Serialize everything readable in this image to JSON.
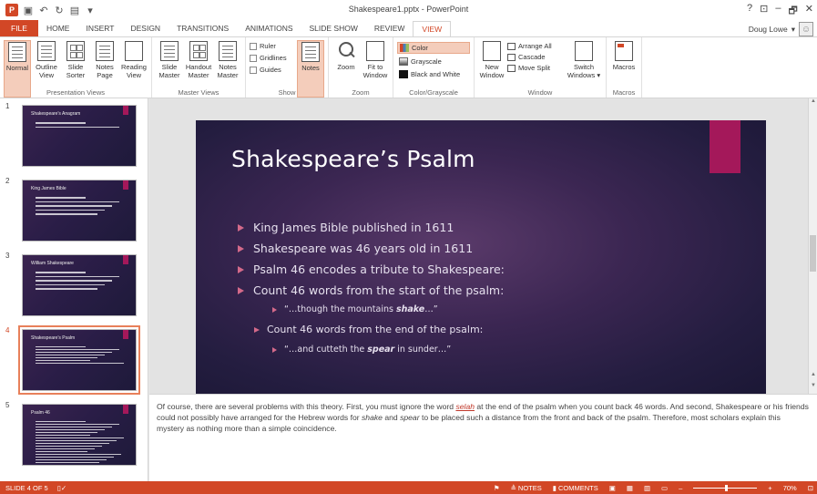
{
  "titlebar": {
    "doc_title": "Shakespeare1.pptx - PowerPoint",
    "app_logo": "P",
    "qat": [
      "save-icon",
      "undo-icon",
      "redo-icon",
      "start-from-beginning-icon",
      "customize-icon"
    ],
    "controls": {
      "help": "?",
      "ribbon_display": "⊡",
      "minimize": "–",
      "restore": "🗗",
      "close": "✕"
    }
  },
  "tabs": [
    {
      "label": "FILE",
      "type": "file"
    },
    {
      "label": "HOME",
      "type": "normal"
    },
    {
      "label": "INSERT",
      "type": "normal"
    },
    {
      "label": "DESIGN",
      "type": "normal"
    },
    {
      "label": "TRANSITIONS",
      "type": "normal"
    },
    {
      "label": "ANIMATIONS",
      "type": "normal"
    },
    {
      "label": "SLIDE SHOW",
      "type": "normal"
    },
    {
      "label": "REVIEW",
      "type": "normal"
    },
    {
      "label": "VIEW",
      "type": "active"
    }
  ],
  "user": {
    "name": "Doug Lowe",
    "caret": "▾"
  },
  "ribbon": {
    "presentation_views": {
      "label": "Presentation Views",
      "buttons": [
        {
          "l1": "Normal",
          "l2": "",
          "selected": true
        },
        {
          "l1": "Outline",
          "l2": "View"
        },
        {
          "l1": "Slide",
          "l2": "Sorter"
        },
        {
          "l1": "Notes",
          "l2": "Page"
        },
        {
          "l1": "Reading",
          "l2": "View"
        }
      ]
    },
    "master_views": {
      "label": "Master Views",
      "buttons": [
        {
          "l1": "Slide",
          "l2": "Master"
        },
        {
          "l1": "Handout",
          "l2": "Master"
        },
        {
          "l1": "Notes",
          "l2": "Master"
        }
      ]
    },
    "show": {
      "label": "Show",
      "checks": [
        "Ruler",
        "Gridlines",
        "Guides"
      ],
      "notes_button": "Notes"
    },
    "zoom": {
      "label": "Zoom",
      "buttons": [
        {
          "l1": "Zoom",
          "l2": ""
        },
        {
          "l1": "Fit to",
          "l2": "Window"
        }
      ]
    },
    "color_grayscale": {
      "label": "Color/Grayscale",
      "items": [
        "Color",
        "Grayscale",
        "Black and White"
      ]
    },
    "window": {
      "label": "Window",
      "new_window": {
        "l1": "New",
        "l2": "Window"
      },
      "items": [
        "Arrange All",
        "Cascade",
        "Move Split"
      ],
      "switch": {
        "l1": "Switch",
        "l2": "Windows ▾"
      }
    },
    "macros": {
      "label": "Macros",
      "button": "Macros"
    }
  },
  "thumbnails": [
    {
      "num": "1",
      "title": "Shakespeare's Anagram",
      "lines": 2,
      "dense": false
    },
    {
      "num": "2",
      "title": "King James Bible",
      "lines": 5,
      "dense": false
    },
    {
      "num": "3",
      "title": "William Shakespeare",
      "lines": 5,
      "dense": false
    },
    {
      "num": "4",
      "title": "Shakespeare's Psalm",
      "lines": 7,
      "dense": true,
      "selected": true
    },
    {
      "num": "5",
      "title": "Psalm 46",
      "lines": 16,
      "dense": true
    }
  ],
  "slide": {
    "title": "Shakespeare’s Psalm",
    "b1": "King James Bible published in 1611",
    "b2": "Shakespeare was 46 years old in 1611",
    "b3": "Psalm 46 encodes a tribute to Shakespeare:",
    "b4": "Count 46 words from the start of the psalm:",
    "b5_pre": "“…though the mountains ",
    "b5_em": "shake",
    "b5_post": "…”",
    "b6": "Count 46 words from the end of the psalm:",
    "b7_pre": "“…and cutteth the ",
    "b7_em": "spear",
    "b7_post": " in sunder…”"
  },
  "notes": {
    "p1": "Of course, there are several problems with this theory. First, you must ignore the word ",
    "selah": "selah",
    "p2": " at the end of the psalm when you count back 46 words. And second, Shakespeare or his friends could not possibly have arranged for the Hebrew words for ",
    "shake": "shake",
    "p3": " and ",
    "spear": "spear",
    "p4": " to be placed such a distance from the front and back of the psalm. Therefore, most scholars explain this mystery as nothing more than a simple coincidence."
  },
  "status": {
    "slide_info": "SLIDE 4 OF 5",
    "notes_label": "≜ NOTES",
    "comments_label": "COMMENTS",
    "zoom_minus": "–",
    "zoom_plus": "+",
    "zoom_value": "70%",
    "zoom_level": 70
  },
  "colors": {
    "accent": "#d24726",
    "slide_accent": "#a4185a"
  }
}
